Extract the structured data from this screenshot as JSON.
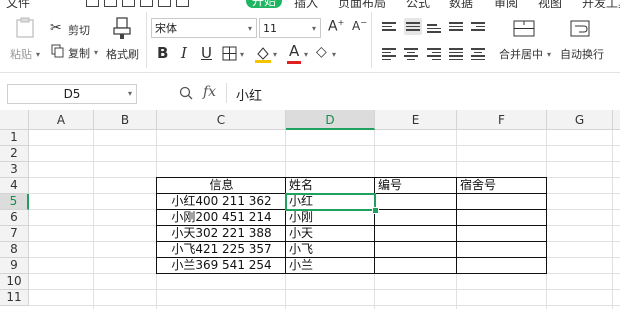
{
  "menu": {
    "items": [
      "文件",
      "开始",
      "插入",
      "页面布局",
      "公式",
      "数据",
      "审阅",
      "视图",
      "开发工具"
    ],
    "active": "开始"
  },
  "ribbon": {
    "paste": "粘贴",
    "cut": "剪切",
    "copy": "复制",
    "format_painter": "格式刷",
    "font_name": "宋体",
    "font_size": "11",
    "merge_center": "合并居中",
    "wrap_text": "自动换行"
  },
  "formula_bar": {
    "name_box": "D5",
    "fx": "fx",
    "content": "小红"
  },
  "columns": [
    "A",
    "B",
    "C",
    "D",
    "E",
    "F",
    "G"
  ],
  "selected_column": "D",
  "rows": [
    "1",
    "2",
    "3",
    "4",
    "5",
    "6",
    "7",
    "8",
    "9",
    "10",
    "11"
  ],
  "selected_row": "5",
  "table": {
    "headers": [
      "信息",
      "姓名",
      "编号",
      "宿舍号"
    ],
    "rows": [
      [
        "小红400  211  362",
        "小红",
        "",
        ""
      ],
      [
        "小刚200  451  214",
        "小刚",
        "",
        ""
      ],
      [
        "小天302  221  388",
        "小天",
        "",
        ""
      ],
      [
        "小飞421  225  357",
        "小飞",
        "",
        ""
      ],
      [
        "小兰369  541  254",
        "小兰",
        "",
        ""
      ]
    ]
  },
  "colors": {
    "accent": "#1fb562",
    "selection": "#1fa05e"
  }
}
